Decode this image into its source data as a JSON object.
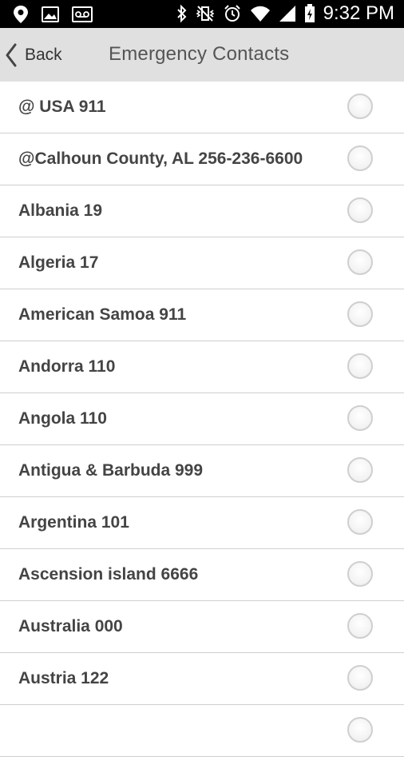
{
  "status_bar": {
    "time": "9:32 PM",
    "left_icons": [
      "location-icon",
      "image-icon",
      "voicemail-icon"
    ],
    "right_icons": [
      "bluetooth-icon",
      "vibrate-icon",
      "alarm-icon",
      "wifi-icon",
      "signal-icon",
      "battery-charging-icon"
    ]
  },
  "header": {
    "back_label": "Back",
    "title": "Emergency Contacts"
  },
  "contacts": [
    {
      "label": "@ USA 911",
      "selected": false
    },
    {
      "label": "@Calhoun County, AL 256-236-6600",
      "selected": false
    },
    {
      "label": "Albania 19",
      "selected": false
    },
    {
      "label": "Algeria 17",
      "selected": false
    },
    {
      "label": "American Samoa 911",
      "selected": false
    },
    {
      "label": "Andorra 110",
      "selected": false
    },
    {
      "label": "Angola 110",
      "selected": false
    },
    {
      "label": "Antigua & Barbuda 999",
      "selected": false
    },
    {
      "label": "Argentina 101",
      "selected": false
    },
    {
      "label": "Ascension island 6666",
      "selected": false
    },
    {
      "label": "Australia 000",
      "selected": false
    },
    {
      "label": "Austria 122",
      "selected": false
    },
    {
      "label": "",
      "selected": false
    }
  ]
}
